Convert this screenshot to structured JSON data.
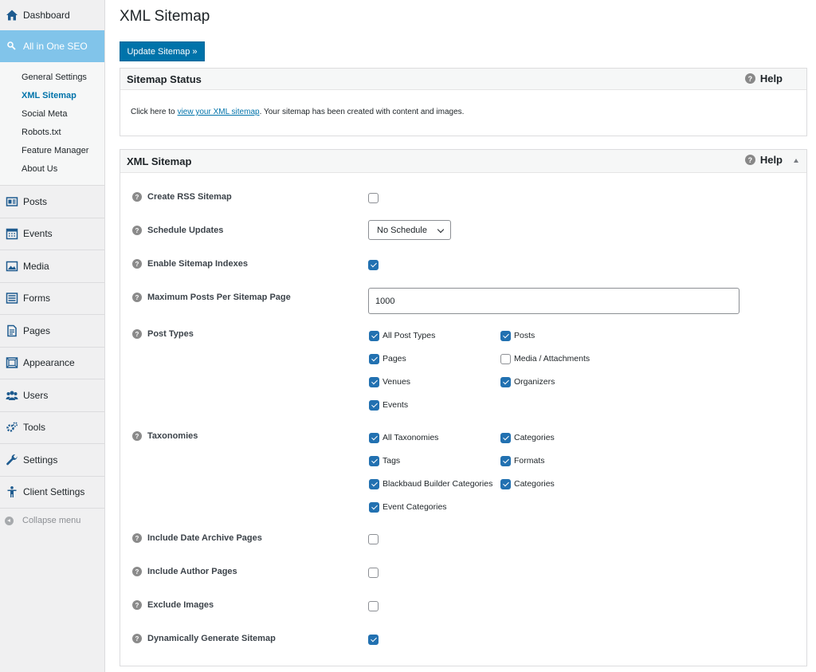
{
  "sidebar": {
    "dashboard": "Dashboard",
    "aioseo": "All in One SEO",
    "submenu": [
      "General Settings",
      "XML Sitemap",
      "Social Meta",
      "Robots.txt",
      "Feature Manager",
      "About Us"
    ],
    "items": [
      "Posts",
      "Events",
      "Media",
      "Forms",
      "Pages",
      "Appearance",
      "Users",
      "Tools",
      "Settings",
      "Client Settings"
    ],
    "collapse": "Collapse menu"
  },
  "page": {
    "title": "XML Sitemap",
    "update_button": "Update Sitemap »"
  },
  "status_box": {
    "title": "Sitemap Status",
    "help": "Help",
    "text_before": "Click here to",
    "link": "view your XML sitemap",
    "text_after": ". Your sitemap has been created with content and images."
  },
  "sitemap_box": {
    "title": "XML Sitemap",
    "help": "Help",
    "q": "?",
    "rows": {
      "rss": "Create RSS Sitemap",
      "schedule": "Schedule Updates",
      "indexes": "Enable Sitemap Indexes",
      "max_posts": "Maximum Posts Per Sitemap Page",
      "post_types": "Post Types",
      "taxonomies": "Taxonomies",
      "date_archive": "Include Date Archive Pages",
      "author": "Include Author Pages",
      "exclude_images": "Exclude Images",
      "dynamic": "Dynamically Generate Sitemap"
    },
    "schedule_value": "No Schedule",
    "max_posts_value": "1000",
    "post_types": [
      "All Post Types",
      "Posts",
      "Pages",
      "Media / Attachments",
      "Venues",
      "Organizers",
      "Events"
    ],
    "post_types_checked": [
      true,
      true,
      true,
      false,
      true,
      true,
      true
    ],
    "taxonomies": [
      "All Taxonomies",
      "Categories",
      "Tags",
      "Formats",
      "Blackbaud Builder Categories",
      "Categories",
      "Event Categories"
    ],
    "taxonomies_checked": [
      true,
      true,
      true,
      true,
      true,
      true,
      true
    ],
    "rss_checked": false,
    "indexes_checked": true,
    "date_archive_checked": false,
    "author_checked": false,
    "exclude_images_checked": false,
    "dynamic_checked": true
  }
}
